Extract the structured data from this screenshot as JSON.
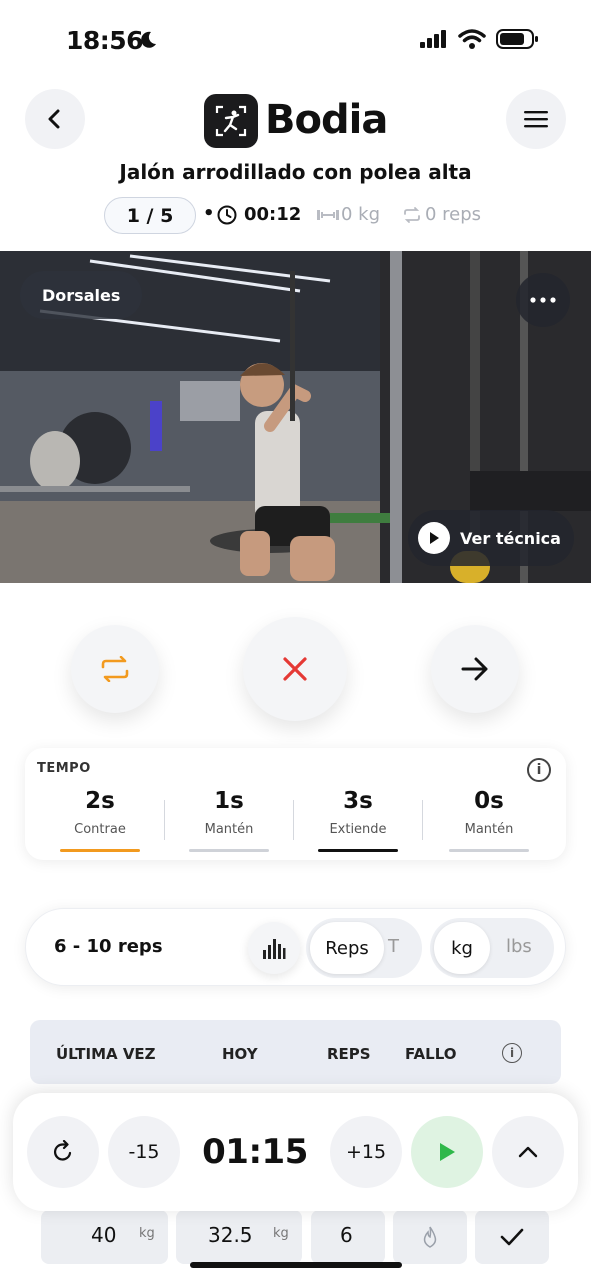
{
  "status_bar": {
    "time": "18:56",
    "moon": "moon-icon",
    "signal": "signal-icon",
    "wifi": "wifi-icon",
    "battery": "battery-icon"
  },
  "header": {
    "app_name": "Bodia",
    "logo": "bodia-logo-icon",
    "back": "chevron-left-icon",
    "menu": "hamburger-icon"
  },
  "exercise": {
    "title": "Jalón arrodillado con polea alta",
    "set_counter": "1 / 5",
    "elapsed": "00:12",
    "weight": "0 kg",
    "reps": "0 reps"
  },
  "video": {
    "muscle_tag": "Dorsales",
    "technique_label": "Ver técnica",
    "more": "ellipsis-icon"
  },
  "actions": {
    "swap": "swap-icon",
    "cancel": "close-icon",
    "next": "arrow-right-icon"
  },
  "tempo": {
    "title": "TEMPO",
    "phases": [
      {
        "value": "2s",
        "label": "Contrae",
        "active_color": "#f29a1f"
      },
      {
        "value": "1s",
        "label": "Mantén",
        "active_color": "#cfd2d8"
      },
      {
        "value": "3s",
        "label": "Extiende",
        "active_color": "#111111"
      },
      {
        "value": "0s",
        "label": "Mantén",
        "active_color": "#cfd2d8"
      }
    ]
  },
  "target": {
    "range": "6 - 10 reps",
    "mode_options": [
      "Reps",
      "T"
    ],
    "mode_selected": "Reps",
    "unit_options": [
      "kg",
      "lbs"
    ],
    "unit_selected": "kg"
  },
  "table_header": {
    "col_last": "ÚLTIMA VEZ",
    "col_today": "HOY",
    "col_reps": "REPS",
    "col_fail": "FALLO"
  },
  "rest_timer": {
    "minus": "-15",
    "time": "01:15",
    "plus": "+15"
  },
  "set_row": {
    "last_weight": "40",
    "last_unit": "kg",
    "today_weight": "32.5",
    "today_unit": "kg",
    "reps": "6"
  },
  "colors": {
    "accent_orange": "#f29a1f",
    "danger_red": "#e53935",
    "play_green": "#2fb84a",
    "play_bg": "#dff3e2"
  }
}
